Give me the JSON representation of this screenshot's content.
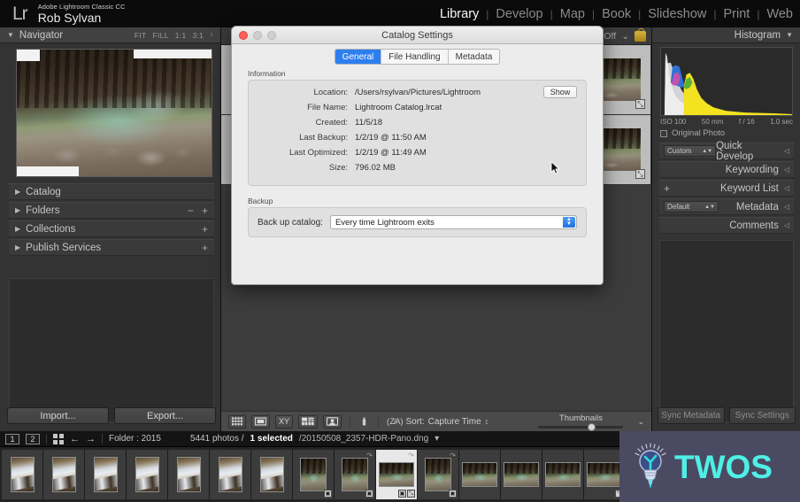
{
  "app": {
    "logo": "Lr",
    "product_line": "Adobe Lightroom Classic CC",
    "identity_name": "Rob Sylvan"
  },
  "modules": [
    {
      "label": "Library",
      "active": true
    },
    {
      "label": "Develop",
      "active": false
    },
    {
      "label": "Map",
      "active": false
    },
    {
      "label": "Book",
      "active": false
    },
    {
      "label": "Slideshow",
      "active": false
    },
    {
      "label": "Print",
      "active": false
    },
    {
      "label": "Web",
      "active": false
    }
  ],
  "module_separator": "|",
  "left_panel": {
    "navigator": {
      "title": "Navigator",
      "triangle": "▼",
      "zoom_levels": [
        "FIT",
        "FILL",
        "1:1",
        "3:1"
      ],
      "stepper": "↕"
    },
    "sections": [
      {
        "label": "Catalog",
        "triangle": "▶",
        "actions": []
      },
      {
        "label": "Folders",
        "triangle": "▶",
        "actions": [
          "−",
          "+"
        ]
      },
      {
        "label": "Collections",
        "triangle": "▶",
        "actions": [
          "+"
        ]
      },
      {
        "label": "Publish Services",
        "triangle": "▶",
        "actions": [
          "+"
        ]
      }
    ],
    "import_label": "Import...",
    "export_label": "Export..."
  },
  "center": {
    "filters_label": "Filters Off",
    "filters_caret": "⌄",
    "lock_icon": "lock-icon",
    "grid_rows": 2,
    "grid_cols": 3,
    "hdr_badge": "⤡"
  },
  "toolbar": {
    "view_grid": "grid-view-icon",
    "view_loupe": "loupe-view-icon",
    "view_compare": "XY",
    "view_survey": "survey-view-icon",
    "view_people": "people-view-icon",
    "spray": "spray-can-icon",
    "sort_icon": "( Z/A )",
    "sort_label": "Sort:",
    "sort_value": "Capture Time",
    "sort_caret": "↕",
    "thumbnails_label": "Thumbnails",
    "toolbar_caret": "⌄"
  },
  "right_panel": {
    "histogram": {
      "title": "Histogram",
      "triangle": "▼",
      "exif": [
        "ISO 100",
        "50 mm",
        "f / 16",
        "1.0 sec"
      ],
      "original_photo_label": "Original Photo"
    },
    "sections": [
      {
        "label": "Quick Develop",
        "control": "select",
        "value": "Custom",
        "arrow": "◁"
      },
      {
        "label": "Keywording",
        "control": "none",
        "value": "",
        "arrow": "◁"
      },
      {
        "label": "Keyword List",
        "control": "plus",
        "value": "+",
        "arrow": "◁"
      },
      {
        "label": "Metadata",
        "control": "select",
        "value": "Default",
        "arrow": "◁"
      },
      {
        "label": "Comments",
        "control": "none",
        "value": "",
        "arrow": "◁"
      }
    ],
    "sync_metadata_label": "Sync Metadata",
    "sync_settings_label": "Sync Settings"
  },
  "filmstrip": {
    "screen_buttons": [
      "1",
      "2"
    ],
    "grid_icon": "filmstrip-grid-icon",
    "back_arrow": "←",
    "forward_arrow": "→",
    "folder_label": "Folder : 2015",
    "photo_count": "5441 photos /",
    "selected_count": "1 selected",
    "selected_file": "/20150508_2357-HDR-Pano.dng",
    "file_caret": "▾",
    "selected_index": 9,
    "thumbs": [
      {
        "type": "portrait",
        "badge": ""
      },
      {
        "type": "portrait",
        "badge": ""
      },
      {
        "type": "portrait",
        "badge": ""
      },
      {
        "type": "portrait",
        "badge": ""
      },
      {
        "type": "portrait",
        "badge": ""
      },
      {
        "type": "portrait",
        "badge": ""
      },
      {
        "type": "portrait",
        "badge": ""
      },
      {
        "type": "portrait-dark",
        "badge": "▣"
      },
      {
        "type": "portrait-dark",
        "badge": "▣"
      },
      {
        "type": "landscape-dark",
        "badge": "⤡"
      },
      {
        "type": "portrait-dark",
        "badge": "▣"
      },
      {
        "type": "landscape",
        "badge": ""
      },
      {
        "type": "landscape",
        "badge": ""
      },
      {
        "type": "landscape",
        "badge": ""
      },
      {
        "type": "landscape",
        "badge": "⤡"
      },
      {
        "type": "landscape",
        "badge": ""
      },
      {
        "type": "landscape",
        "badge": ""
      },
      {
        "type": "landscape",
        "badge": ""
      },
      {
        "type": "landscape",
        "badge": ""
      }
    ]
  },
  "dialog": {
    "title": "Catalog Settings",
    "traffic_lights": [
      "close",
      "minimize",
      "maximize"
    ],
    "tabs": [
      {
        "label": "General",
        "active": true
      },
      {
        "label": "File Handling",
        "active": false
      },
      {
        "label": "Metadata",
        "active": false
      }
    ],
    "information": {
      "group_label": "Information",
      "rows": [
        {
          "label": "Location:",
          "value": "/Users/rsylvan/Pictures/Lightroom"
        },
        {
          "label": "File Name:",
          "value": "Lightroom Catalog.lrcat"
        },
        {
          "label": "Created:",
          "value": "11/5/18"
        },
        {
          "label": "Last Backup:",
          "value": "1/2/19 @ 11:50 AM"
        },
        {
          "label": "Last Optimized:",
          "value": "1/2/19 @ 11:49 AM"
        },
        {
          "label": "Size:",
          "value": "796.02 MB"
        }
      ],
      "show_button": "Show"
    },
    "backup": {
      "group_label": "Backup",
      "row_label": "Back up catalog:",
      "value": "Every time Lightroom exits",
      "stepper_up": "▲",
      "stepper_down": "▼"
    }
  },
  "watermark": {
    "text": "TWOS",
    "icon": "lightbulb-icon",
    "background_color": "#4b4a63",
    "text_color": "#4ef0e6"
  }
}
